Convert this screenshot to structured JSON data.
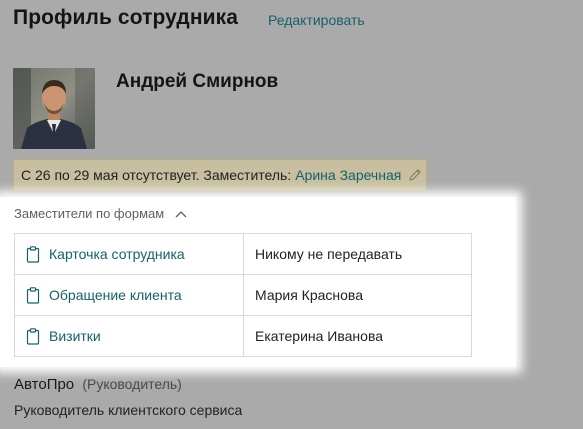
{
  "header": {
    "title": "Профиль сотрудника",
    "edit_label": "Редактировать"
  },
  "employee": {
    "name": "Андрей Смирнов"
  },
  "absence": {
    "text": "С 26 по 29 мая отсутствует. Заместитель:",
    "deputy_name": "Арина Заречная"
  },
  "forms_section": {
    "title": "Заместители по формам",
    "expanded": true,
    "rows": [
      {
        "form": "Карточка сотрудника",
        "deputy": "Никому не передавать"
      },
      {
        "form": "Обращение клиента",
        "deputy": "Мария Краснова"
      },
      {
        "form": "Визитки",
        "deputy": "Екатерина Иванова"
      }
    ]
  },
  "organization": {
    "company": "АвтоПро",
    "role": "(Руководитель)",
    "position": "Руководитель клиентского сервиса"
  },
  "colors": {
    "accent": "#17616a",
    "background": "#aaaaaa",
    "banner": "#c7bf9f"
  }
}
